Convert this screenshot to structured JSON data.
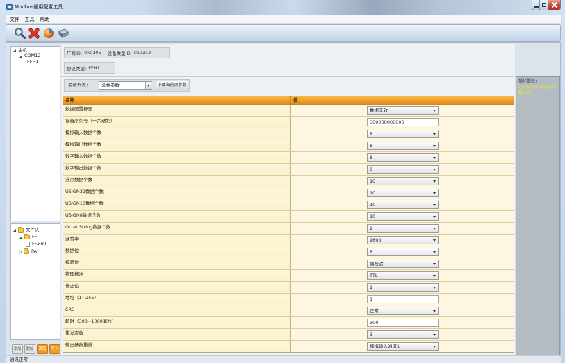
{
  "window": {
    "title": "Modbus通用配置工具",
    "app_icon": "app-icon",
    "control_icons": [
      "minimize-icon",
      "maximize-icon",
      "close-icon"
    ]
  },
  "menu": [
    {
      "label": "文件"
    },
    {
      "label": "工具"
    },
    {
      "label": "帮助"
    }
  ],
  "toolbar": {
    "icons": [
      "search-icon",
      "delete-icon",
      "globe-icon",
      "device-icon"
    ]
  },
  "device_tree": {
    "label": "主机",
    "expanded": true,
    "children": [
      {
        "label": "COM12",
        "expanded": true,
        "children": [
          {
            "label": "FFH1"
          }
        ]
      }
    ]
  },
  "file_tree": {
    "label": "文件夹",
    "icon": "folder-icon",
    "expanded": true,
    "children": [
      {
        "label": "FF",
        "icon": "folder-icon",
        "expanded": true,
        "children": [
          {
            "label": "FF.xml",
            "icon": "file-icon"
          }
        ]
      },
      {
        "label": "PA",
        "icon": "folder-icon",
        "expanded": false
      }
    ]
  },
  "side_buttons": [
    {
      "label": "添加"
    },
    {
      "label": "删除"
    },
    {
      "label": "读取"
    },
    {
      "label": "写入"
    }
  ],
  "device_info": {
    "vendor_id_label": "厂商ID:",
    "vendor_id": "0x0105",
    "device_type_label": "设备类型ID:",
    "device_type": "0x0312",
    "protocol_label": "协议类型:",
    "protocol": "FFH1"
  },
  "param_list": {
    "label": "参数列表：",
    "selected": "公共参数",
    "download_label": "下载当前页参数"
  },
  "param_table": {
    "headers": {
      "name": "名称",
      "value": "值"
    },
    "rows": [
      {
        "name": "数据配置标志",
        "value": "数据无效",
        "control": "select"
      },
      {
        "name": "设备序列号（十六进制）",
        "value": "000000000000",
        "control": "input"
      },
      {
        "name": "模拟输入数据个数",
        "value": "8",
        "control": "select"
      },
      {
        "name": "模拟输出数据个数",
        "value": "8",
        "control": "select"
      },
      {
        "name": "数字输入数据个数",
        "value": "8",
        "control": "select"
      },
      {
        "name": "数字输出数据个数",
        "value": "8",
        "control": "select"
      },
      {
        "name": "浮点数据个数",
        "value": "10",
        "control": "select"
      },
      {
        "name": "USIGN32数据个数",
        "value": "10",
        "control": "select"
      },
      {
        "name": "USIGN16数据个数",
        "value": "10",
        "control": "select"
      },
      {
        "name": "USIGN8数据个数",
        "value": "10",
        "control": "select"
      },
      {
        "name": "Octet String数据个数",
        "value": "2",
        "control": "select"
      },
      {
        "name": "波特率",
        "value": "9600",
        "control": "select"
      },
      {
        "name": "数据位",
        "value": "8",
        "control": "select"
      },
      {
        "name": "校验位",
        "value": "偶校验",
        "control": "select"
      },
      {
        "name": "物理标准",
        "value": "TTL",
        "control": "select"
      },
      {
        "name": "停止位",
        "value": "1",
        "control": "select"
      },
      {
        "name": "地址（1~255）",
        "value": "1",
        "control": "input"
      },
      {
        "name": "CRC",
        "value": "正常",
        "control": "select"
      },
      {
        "name": "超时（300~1000毫秒）",
        "value": "300",
        "control": "input"
      },
      {
        "name": "重发次数",
        "value": "3",
        "control": "select"
      },
      {
        "name": "输出参数重量",
        "value": "模拟输入通道1",
        "control": "select"
      }
    ]
  },
  "hint": {
    "title": "操作提示：",
    "message": "已完成读取设备的参数上传。"
  },
  "status": {
    "text": "通讯正常"
  },
  "colors": {
    "table_header": "#ef9b29",
    "table_row": "#fbf1ce",
    "action_button": "#f29b1f",
    "hint_text": "#e5e24a",
    "close_button": "#c8473b"
  }
}
